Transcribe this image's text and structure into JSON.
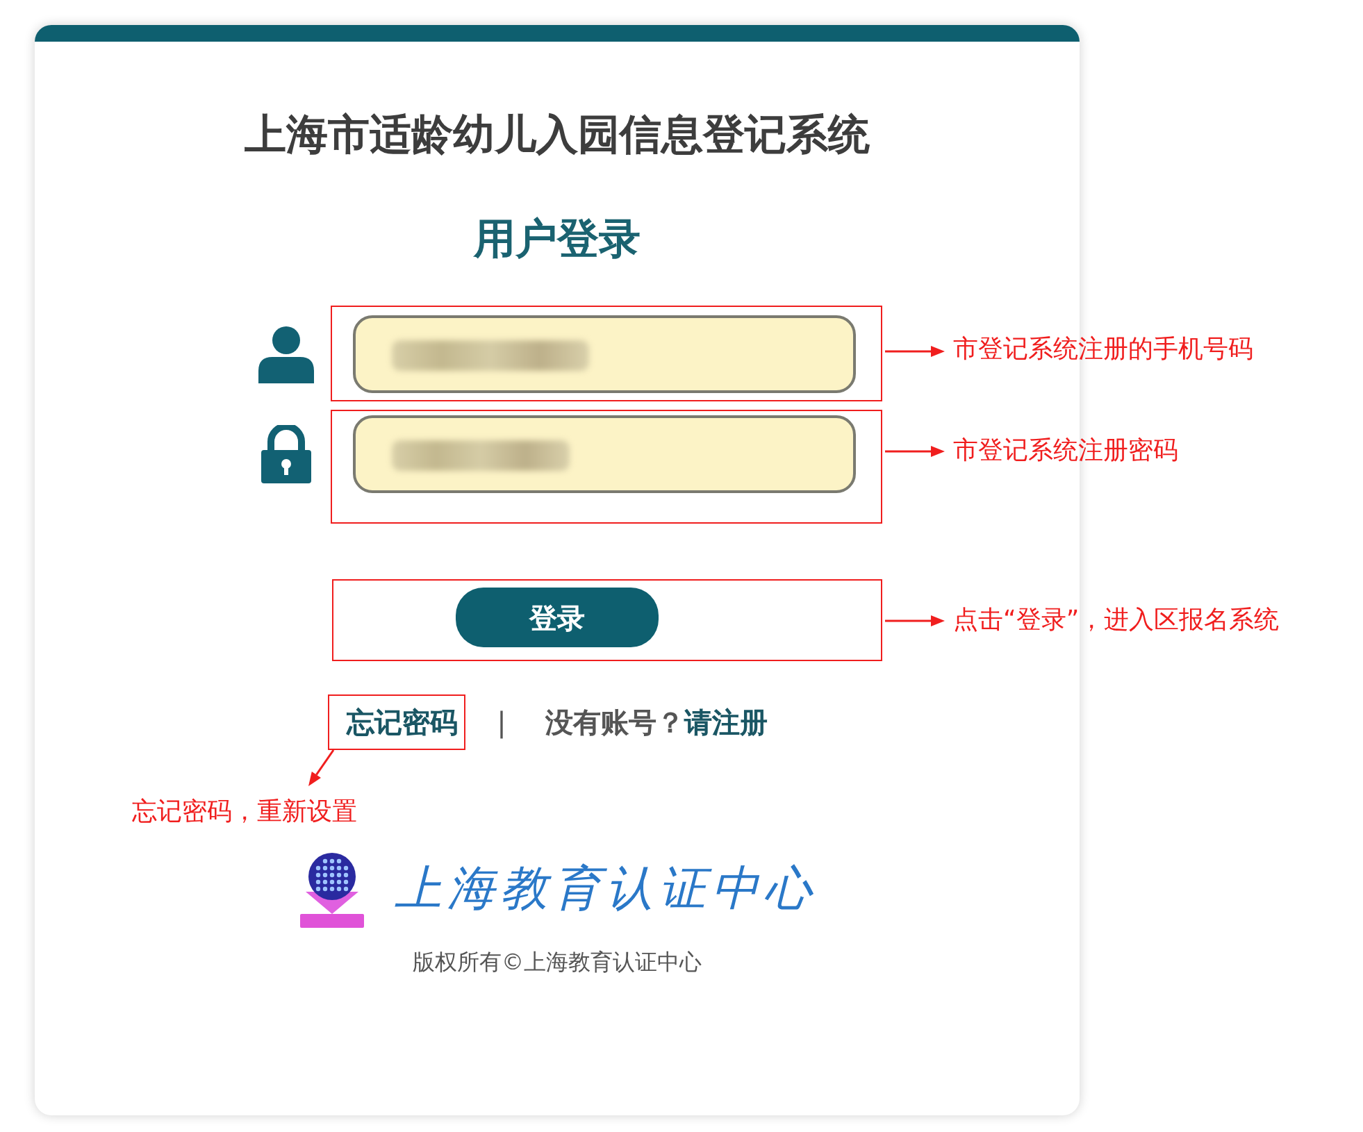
{
  "title": "上海市适龄幼儿入园信息登记系统",
  "heading": "用户登录",
  "fields": [
    {
      "kind": "user"
    },
    {
      "kind": "password"
    }
  ],
  "login_button": "登录",
  "links": {
    "forgot": "忘记密码",
    "separator": "|",
    "prompt": "没有账号？",
    "register": "请注册"
  },
  "logo_text": "上海教育认证中心",
  "copyright": "版权所有©上海教育认证中心",
  "annotations": [
    {
      "text": "市登记系统注册的手机号码"
    },
    {
      "text": "市登记系统注册密码"
    },
    {
      "text": "点击“登录”，进入区报名系统"
    },
    {
      "text": "忘记密码，重新设置"
    }
  ]
}
